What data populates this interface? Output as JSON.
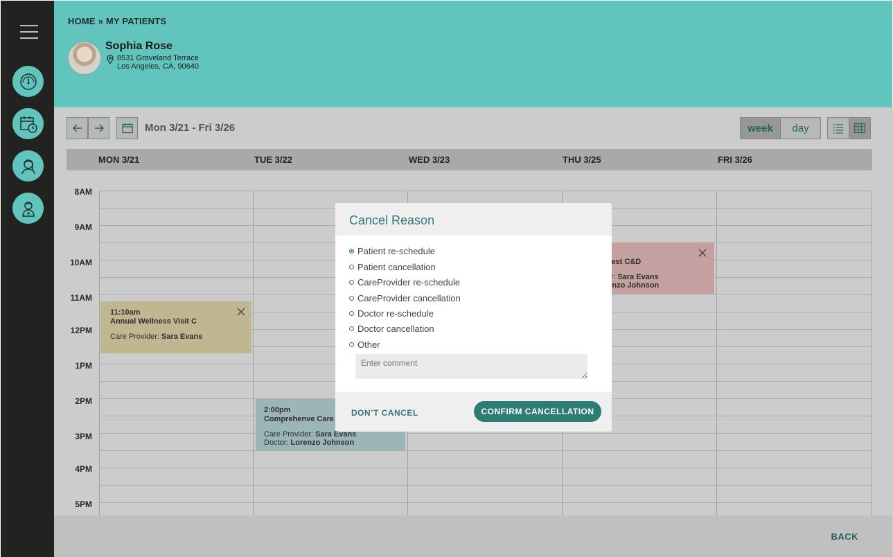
{
  "breadcrumb": "HOME » MY PATIENTS",
  "patient": {
    "name": "Sophia Rose",
    "address_line1": "8531 Groveland Terrace",
    "address_line2": "Los Angeles, CA, 90640"
  },
  "sidebar": {
    "items": [
      {
        "icon": "dashboard-icon"
      },
      {
        "icon": "calendar-clock-icon"
      },
      {
        "icon": "doctor-icon"
      },
      {
        "icon": "caregiver-icon"
      }
    ]
  },
  "toolbar": {
    "date_range": "Mon 3/21 - Fri 3/26",
    "week_label": "week",
    "day_label": "day",
    "active_view": "week"
  },
  "days": [
    "MON 3/21",
    "TUE 3/22",
    "WED 3/23",
    "THU 3/25",
    "FRI 3/26"
  ],
  "hours": [
    "8AM",
    "9AM",
    "10AM",
    "11AM",
    "12PM",
    "1PM",
    "2PM",
    "3PM",
    "4PM",
    "5PM"
  ],
  "events": [
    {
      "time": "11:10am",
      "title": "Annual Wellness Visit C",
      "provider_label": "Care Provider:",
      "provider": "Sara Evans"
    },
    {
      "time": "2:00pm",
      "title": "Comprehenve Care I",
      "provider_label": "Care Provider:",
      "provider": "Sara Evans",
      "doctor_label": "Doctor:",
      "doctor": "Lorenzo Johnson"
    },
    {
      "title": "quest C&D",
      "provider_label": "ler:",
      "provider": "Sara Evans",
      "doctor": "renzo Johnson"
    }
  ],
  "modal": {
    "title": "Cancel Reason",
    "options": [
      "Patient re-schedule",
      "Patient cancellation",
      "CareProvider re-schedule",
      "CareProvider cancellation",
      "Doctor re-schedule",
      "Doctor cancellation",
      "Other"
    ],
    "selected_index": 0,
    "comment_placeholder": "Enter comment",
    "dont_cancel_label": "DON’T CANCEL",
    "confirm_label": "CONFIRM CANCELLATION"
  },
  "footer": {
    "back_label": "BACK"
  },
  "colors": {
    "teal": "#62c5bd",
    "teal_dark": "#2d7d75",
    "sidebar": "#222220"
  }
}
